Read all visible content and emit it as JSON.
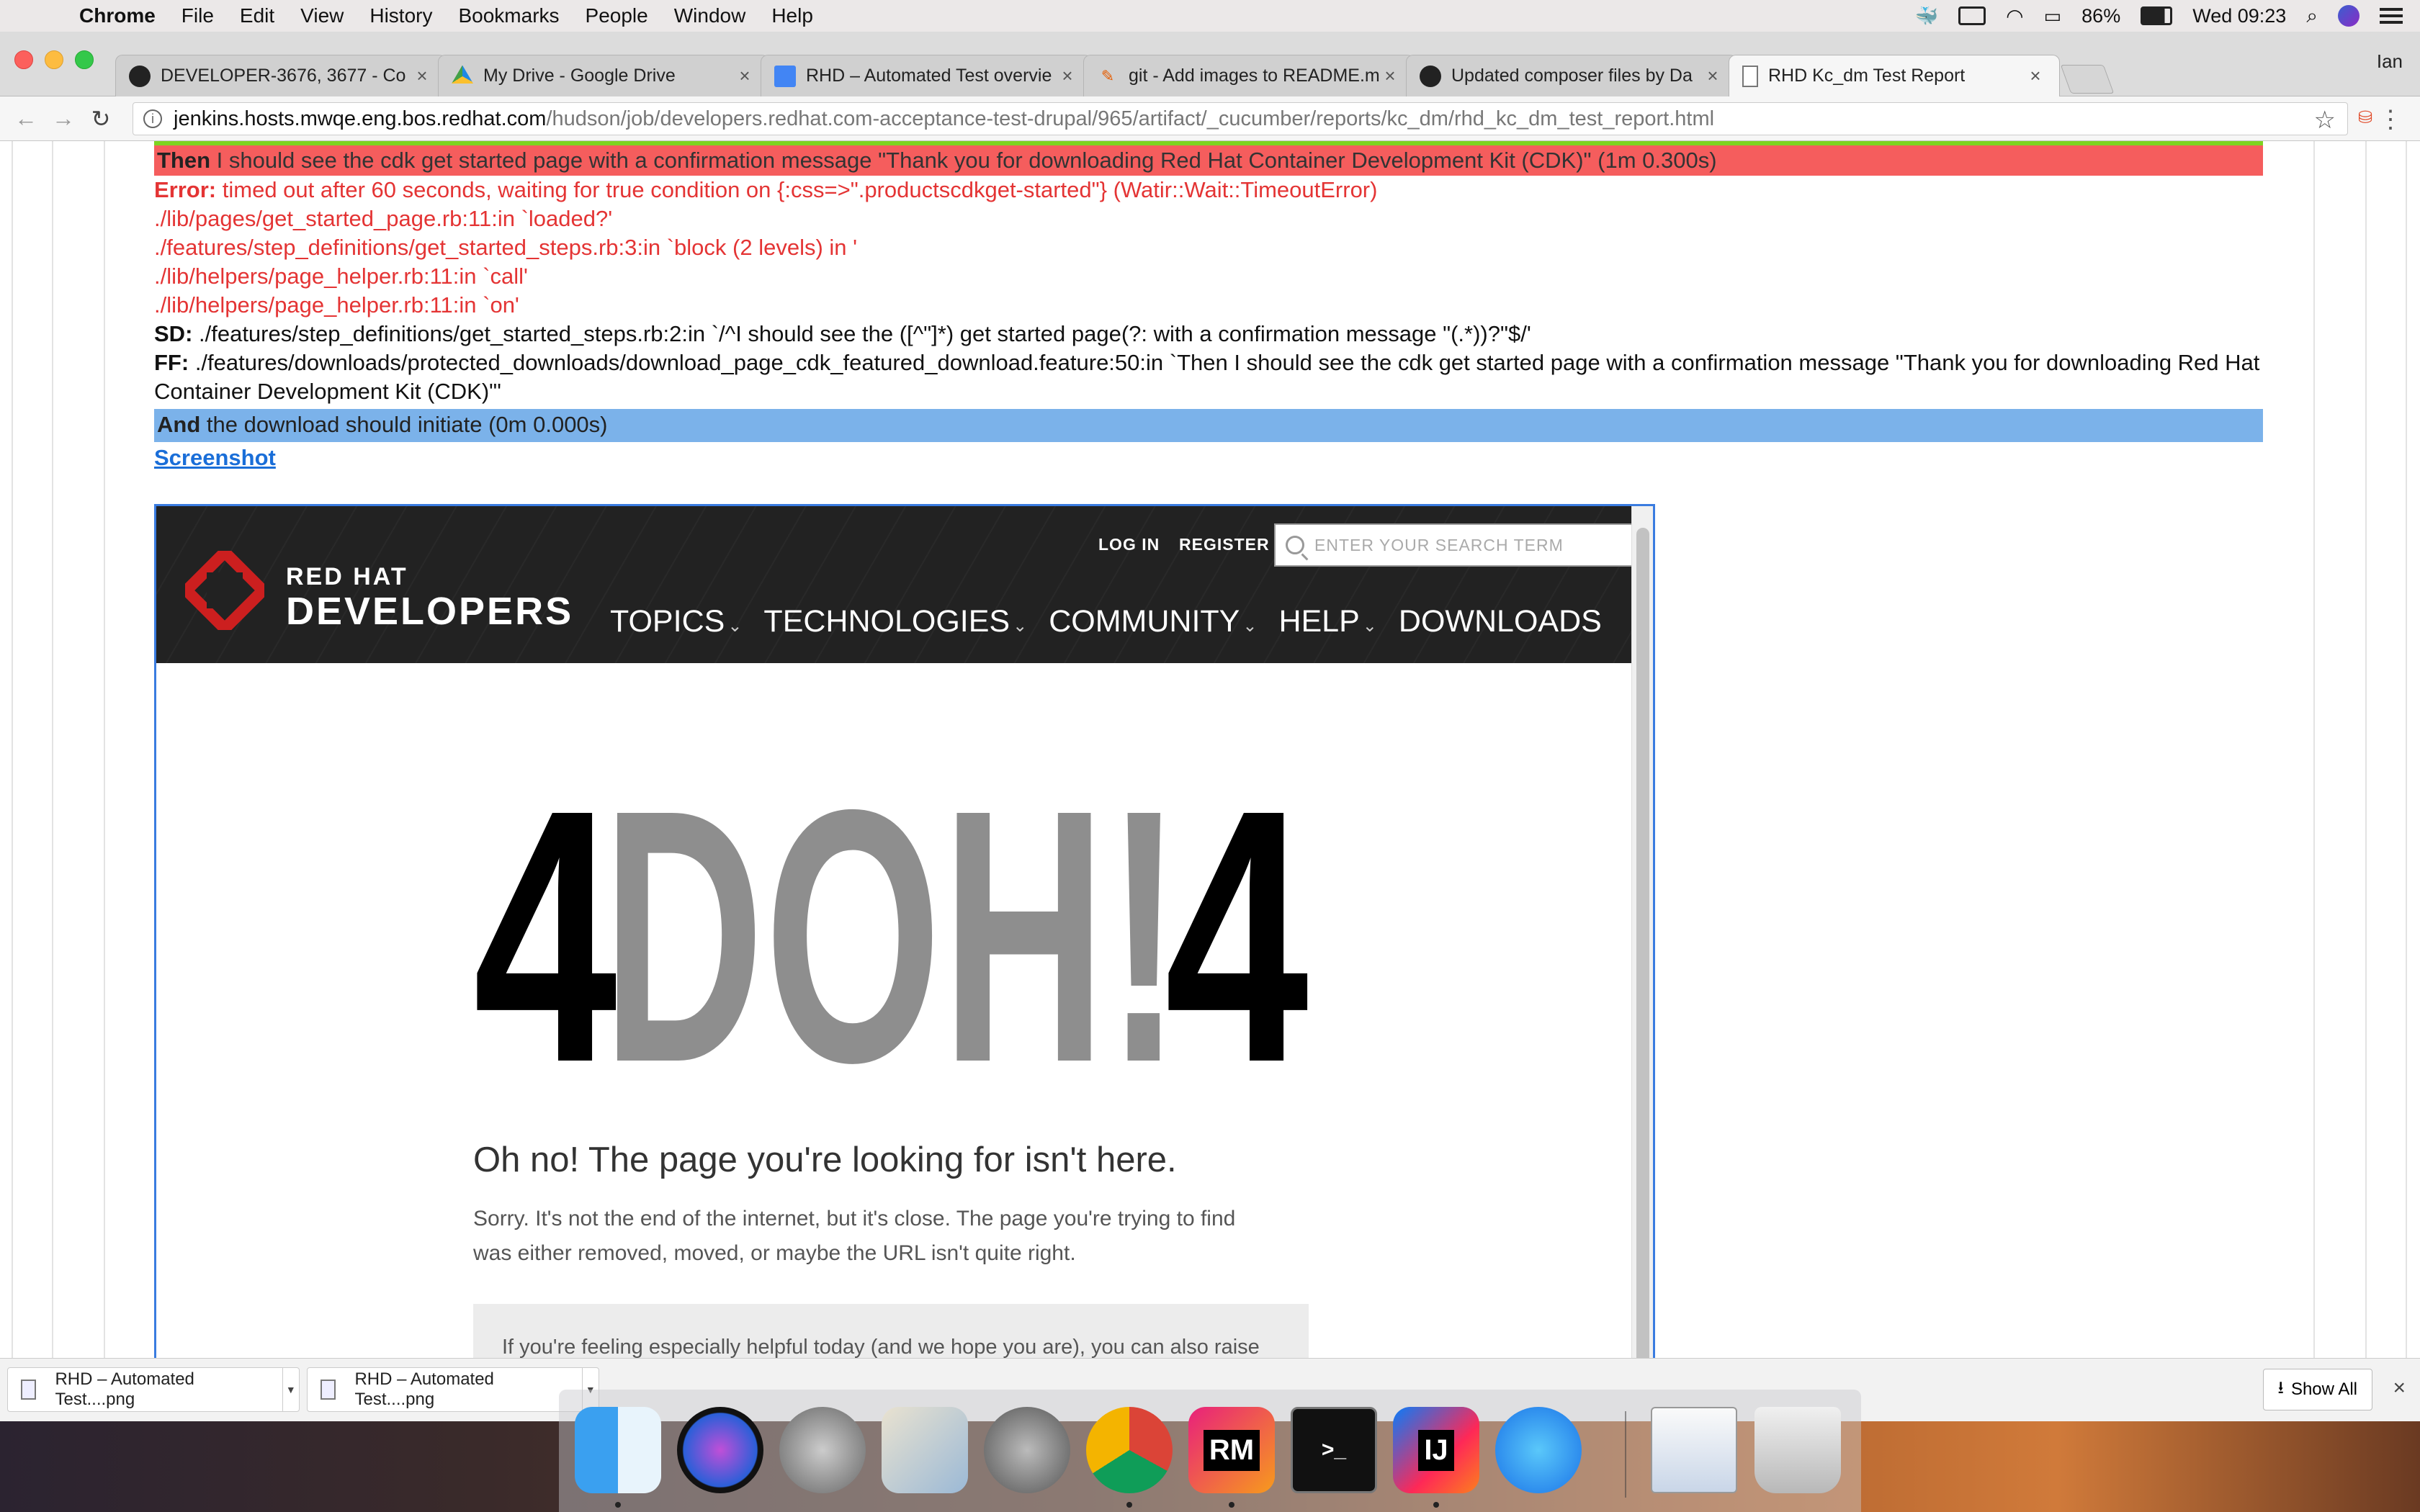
{
  "menubar": {
    "app": "Chrome",
    "items": [
      "File",
      "Edit",
      "View",
      "History",
      "Bookmarks",
      "People",
      "Window",
      "Help"
    ],
    "battery": "86%",
    "clock": "Wed 09:23"
  },
  "browser": {
    "profile": "Ian",
    "tabs": [
      {
        "title": "DEVELOPER-3676, 3677 - Co",
        "icon": "github-icon"
      },
      {
        "title": "My Drive - Google Drive",
        "icon": "google-drive-icon"
      },
      {
        "title": "RHD – Automated Test overvie",
        "icon": "google-docs-icon"
      },
      {
        "title": "git - Add images to README.m",
        "icon": "git-icon"
      },
      {
        "title": "Updated composer files by Da",
        "icon": "github-icon"
      },
      {
        "title": "RHD Kc_dm Test Report",
        "icon": "file-icon",
        "active": true
      }
    ],
    "url_host": "jenkins.hosts.mwqe.eng.bos.redhat.com",
    "url_path": "/hudson/job/developers.redhat.com-acceptance-test-drupal/965/artifact/_cucumber/reports/kc_dm/rhd_kc_dm_test_report.html"
  },
  "report": {
    "failed_step": {
      "keyword": "Then",
      "text": " I should see the cdk get started page with a confirmation message \"Thank you for downloading Red Hat Container Development Kit (CDK)\" (1m 0.300s)"
    },
    "error": {
      "label": "Error:",
      "message": " timed out after 60 seconds, waiting for true condition on {:css=>\".productscdkget-started\"} (Watir::Wait::TimeoutError)",
      "trace": [
        "./lib/pages/get_started_page.rb:11:in `loaded?'",
        "./features/step_definitions/get_started_steps.rb:3:in `block (2 levels) in '",
        "./lib/helpers/page_helper.rb:11:in `call'",
        "./lib/helpers/page_helper.rb:11:in `on'"
      ]
    },
    "sd": {
      "label": "SD:",
      "text": " ./features/step_definitions/get_started_steps.rb:2:in `/^I should see the ([^\"]*) get started page(?: with a confirmation message \"(.*))?\"$/'"
    },
    "ff": {
      "label": "FF:",
      "text": " ./features/downloads/protected_downloads/download_page_cdk_featured_download.feature:50:in `Then I should see the cdk get started page with a confirmation message \"Thank you for downloading Red Hat Container Development Kit (CDK)\"'"
    },
    "skipped_step": {
      "keyword": "And",
      "text": " the download should initiate (0m 0.000s)"
    },
    "screenshot_link": "Screenshot"
  },
  "screenshot": {
    "logo_line1": "RED HAT",
    "logo_line2": "DEVELOPERS",
    "login": "LOG IN",
    "register": "REGISTER",
    "search_placeholder": "ENTER YOUR SEARCH TERM",
    "nav": [
      "TOPICS",
      "TECHNOLOGIES",
      "COMMUNITY",
      "HELP",
      "DOWNLOADS"
    ],
    "doh": "4DOH!4",
    "heading": "Oh no! The page you're looking for isn't here.",
    "body": "Sorry. It's not the end of the internet, but it's close. The page you're trying to find was either removed, moved, or maybe the URL isn't quite right.",
    "box": "If you're feeling especially helpful today (and we hope you are), you can also raise"
  },
  "downloads": {
    "items": [
      "RHD – Automated Test....png",
      "RHD – Automated Test....png"
    ],
    "show_all": "Show All"
  },
  "dock": {
    "apps": [
      "Finder",
      "Siri",
      "Launchpad",
      "Mail",
      "System Preferences",
      "Chrome",
      "RubyMine",
      "Terminal",
      "IntelliJ IDEA",
      "Messages",
      "Preview",
      "Trash"
    ],
    "rubymine_label": "RM",
    "intellij_label": "IJ",
    "terminal_label": ">_"
  }
}
